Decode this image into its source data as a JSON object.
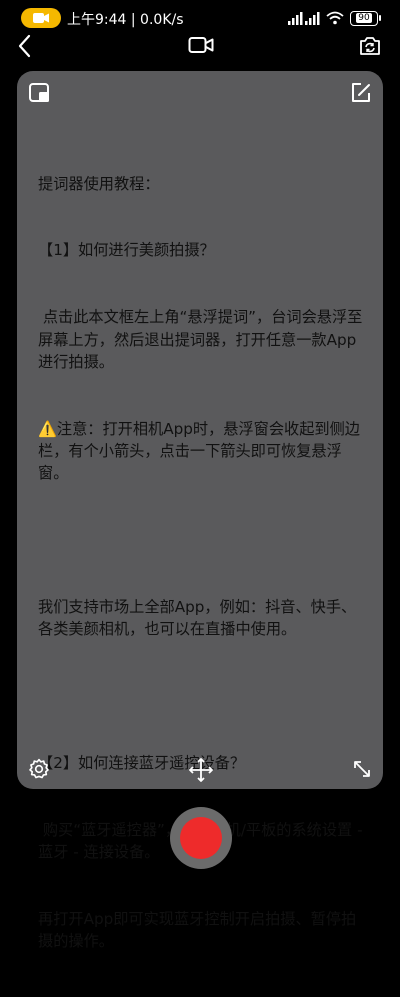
{
  "status_bar": {
    "time_speed": "上午9:44 | 0.0K/s",
    "battery": "90"
  },
  "nav": {
    "back_icon": "chevron-left-icon",
    "video_icon": "video-camera-icon",
    "switch_camera_icon": "camera-switch-icon"
  },
  "card": {
    "float_icon": "float-window-icon",
    "edit_icon": "edit-icon",
    "settings_icon": "gear-icon",
    "move_icon": "move-arrows-icon",
    "resize_icon": "resize-diagonal-icon",
    "lines": [
      "提词器使用教程：",
      "【1】如何进行美颜拍摄？",
      " 点击此本文框左上角“悬浮提词”，台词会悬浮至屏幕上方，然后退出提词器，打开任意一款App进行拍摄。",
      "⚠️注意：打开相机App时，悬浮窗会收起到侧边栏，有个小箭头，点击一下箭头即可恢复悬浮窗。",
      "",
      "我们支持市场上全部App，例如：抖音、快手、各类美颜相机，也可以在直播中使用。",
      "",
      "【2】如何连接蓝牙遥控设备？",
      " 购买“蓝牙遥控器”，点击手机/平板的系统设置 - 蓝牙 - 连接设备。",
      "再打开App即可实现蓝牙控制开启拍摄、暂停拍摄的操作。"
    ]
  },
  "record": {
    "color": "#ee2b2b"
  }
}
